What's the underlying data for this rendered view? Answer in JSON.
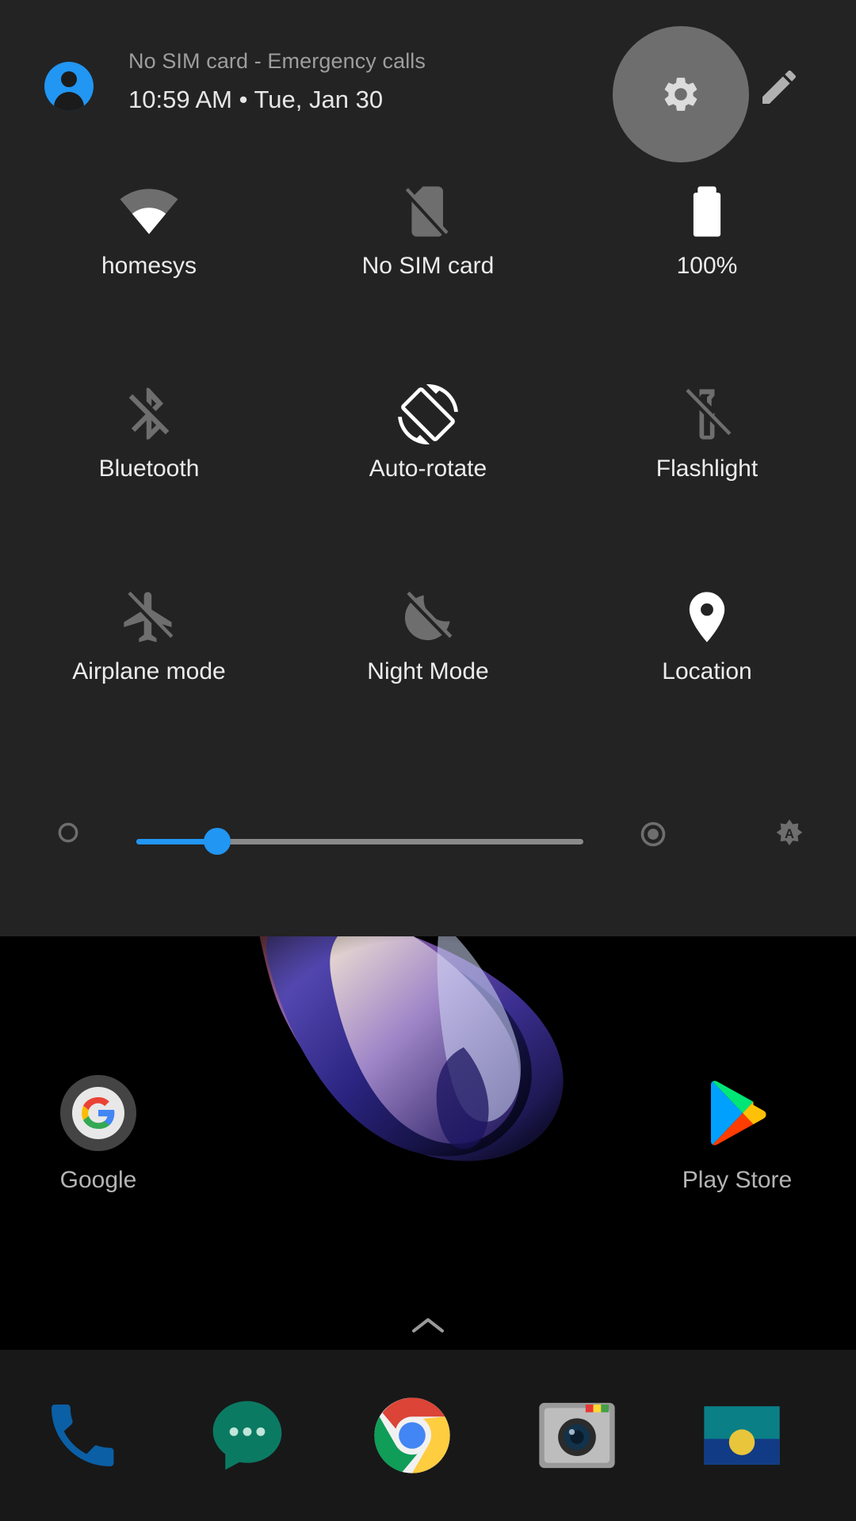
{
  "quick_settings": {
    "header": {
      "avatar_icon": "user-avatar-icon",
      "carrier_status": "No SIM card - Emergency calls",
      "clock_date": "10:59 AM  •  Tue, Jan 30",
      "settings_icon": "gear-icon",
      "edit_icon": "pencil-icon"
    },
    "tiles": [
      {
        "label": "homesys",
        "icon": "wifi-icon",
        "state": "on"
      },
      {
        "label": "No SIM card",
        "icon": "sim-card-off-icon",
        "state": "off"
      },
      {
        "label": "100%",
        "icon": "battery-full-icon",
        "state": "on"
      },
      {
        "label": "Bluetooth",
        "icon": "bluetooth-off-icon",
        "state": "off"
      },
      {
        "label": "Auto-rotate",
        "icon": "auto-rotate-icon",
        "state": "on"
      },
      {
        "label": "Flashlight",
        "icon": "flashlight-off-icon",
        "state": "off"
      },
      {
        "label": "Airplane mode",
        "icon": "airplane-off-icon",
        "state": "off"
      },
      {
        "label": "Night Mode",
        "icon": "night-mode-off-icon",
        "state": "off"
      },
      {
        "label": "Location",
        "icon": "location-pin-icon",
        "state": "on"
      }
    ],
    "brightness": {
      "low_icon": "brightness-low-icon",
      "high_icon": "brightness-high-icon",
      "auto_icon": "brightness-auto-icon",
      "value_percent": 18,
      "accent_color": "#2196f3"
    }
  },
  "home_screen": {
    "apps": [
      {
        "label": "Google",
        "icon": "google-g-icon"
      },
      {
        "label": "Play Store",
        "icon": "play-store-icon"
      }
    ],
    "app_drawer_handle_icon": "chevron-up-icon",
    "dock": [
      {
        "label": "Phone",
        "icon": "phone-icon"
      },
      {
        "label": "Messages",
        "icon": "messages-icon"
      },
      {
        "label": "Chrome",
        "icon": "chrome-icon"
      },
      {
        "label": "Camera",
        "icon": "camera-icon"
      },
      {
        "label": "Photos",
        "icon": "photos-icon"
      }
    ]
  }
}
